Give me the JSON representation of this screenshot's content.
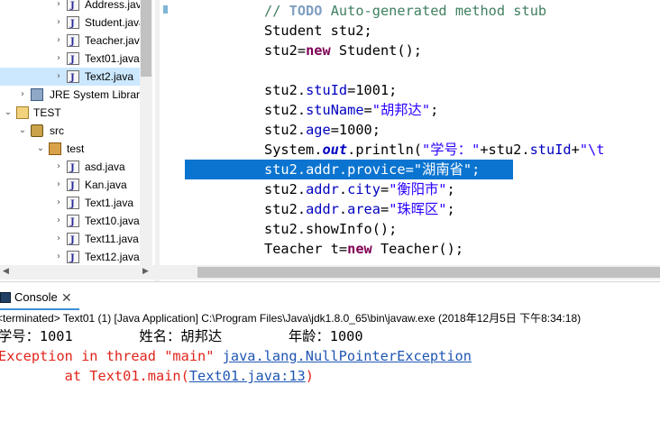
{
  "explorer": {
    "items": [
      {
        "label": "Address.java",
        "icon": "java-file-icon",
        "arrow": "›"
      },
      {
        "label": "Student.java",
        "icon": "java-file-icon",
        "arrow": "›"
      },
      {
        "label": "Teacher.java",
        "icon": "java-file-icon",
        "arrow": "›"
      },
      {
        "label": "Text01.java",
        "icon": "java-file-icon",
        "arrow": "›"
      },
      {
        "label": "Text2.java",
        "icon": "java-file-icon",
        "arrow": "›"
      },
      {
        "label": "JRE System Library",
        "icon": "library-icon",
        "arrow": "›"
      },
      {
        "label": "TEST",
        "icon": "project-icon",
        "arrow": "⌄"
      },
      {
        "label": "src",
        "icon": "source-folder-icon",
        "arrow": "⌄"
      },
      {
        "label": "test",
        "icon": "package-icon",
        "arrow": "⌄"
      },
      {
        "label": "asd.java",
        "icon": "java-file-icon",
        "arrow": "›"
      },
      {
        "label": "Kan.java",
        "icon": "java-file-icon",
        "arrow": "›"
      },
      {
        "label": "Text1.java",
        "icon": "java-file-icon",
        "arrow": "›"
      },
      {
        "label": "Text10.java",
        "icon": "java-file-icon",
        "arrow": "›"
      },
      {
        "label": "Text11.java",
        "icon": "java-file-icon",
        "arrow": "›"
      },
      {
        "label": "Text12.java",
        "icon": "java-file-icon",
        "arrow": "›"
      }
    ]
  },
  "editor": {
    "lines": [
      "// TODO Auto-generated method stub",
      "Student stu2;",
      "stu2=new Student();",
      "",
      "stu2.stuId=1001;",
      "stu2.stuName=\"胡邦达\";",
      "stu2.age=1000;",
      "System.out.println(\"学号：\"+stu2.stuId+\"\\t",
      "stu2.addr.provice=\"湖南省\";",
      "stu2.addr.city=\"衡阳市\";",
      "stu2.addr.area=\"珠晖区\";",
      "stu2.showInfo();",
      "Teacher t=new Teacher();"
    ]
  },
  "console": {
    "tab_label": "Console",
    "tab_close": "✕",
    "status": "<terminated> Text01 (1) [Java Application] C:\\Program Files\\Java\\jdk1.8.0_65\\bin\\javaw.exe (2018年12月5日 下午8:34:18)",
    "output_line": "学号：1001        姓名：胡邦达        年龄：1000",
    "exception_prefix": "Exception in thread \"main\" ",
    "exception_class": "java.lang.NullPointerException",
    "trace_prefix": "        at Text01.main(",
    "trace_link": "Text01.java:13",
    "trace_suffix": ")"
  },
  "colors": {
    "selection": "#0a74d0",
    "keyword": "#7f0055",
    "field": "#0000c0",
    "string": "#2a00ff",
    "comment": "#3f7f5f",
    "error": "#e0241b",
    "link": "#1f56b3"
  }
}
